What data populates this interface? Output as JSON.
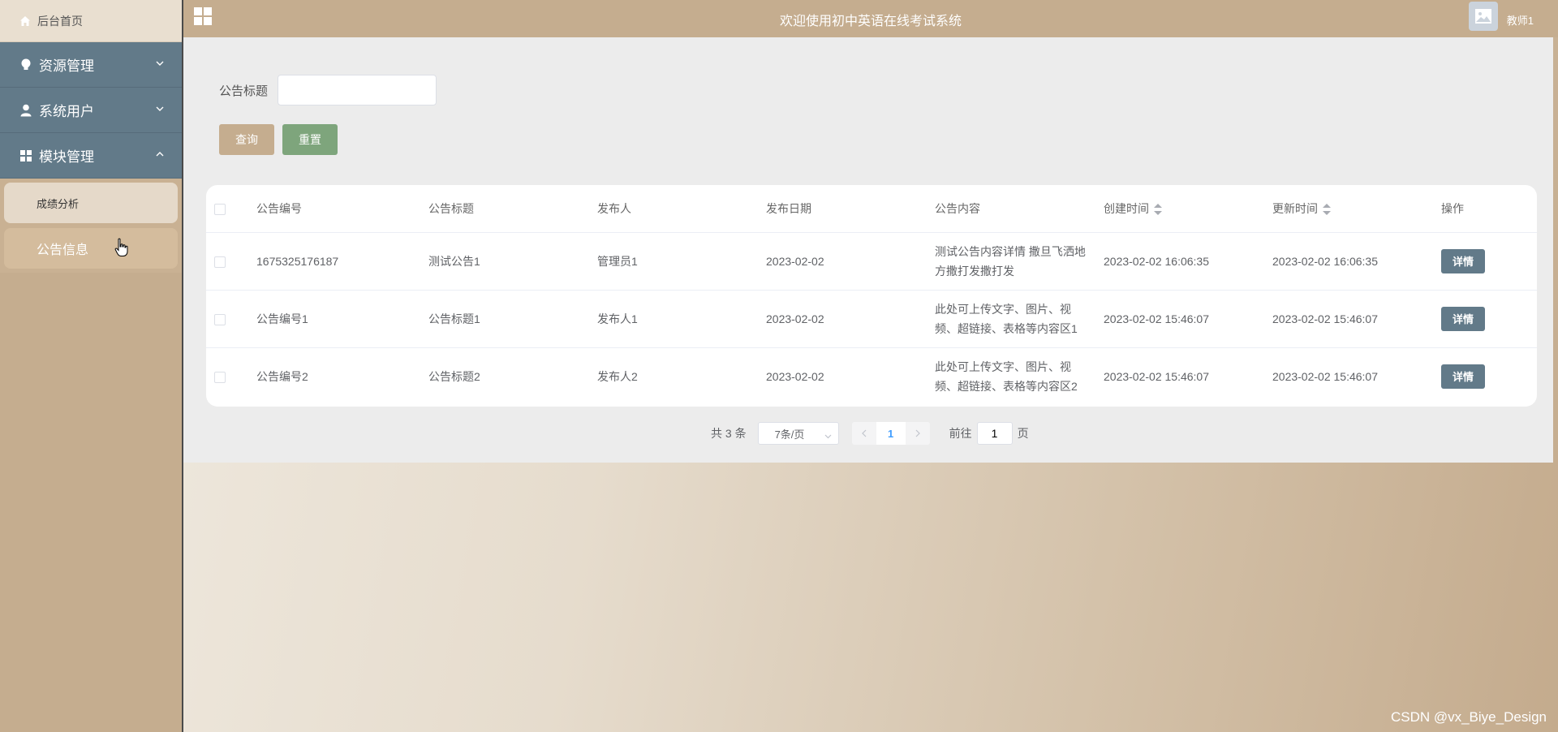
{
  "header": {
    "title": "欢迎使用初中英语在线考试系统",
    "user": "教师1"
  },
  "sidebar": {
    "home": "后台首页",
    "groups": [
      {
        "label": "资源管理",
        "icon": "bulb-icon"
      },
      {
        "label": "系统用户",
        "icon": "user-icon"
      },
      {
        "label": "模块管理",
        "icon": "grid-icon"
      }
    ],
    "sub_items": [
      {
        "label": "成绩分析"
      },
      {
        "label": "公告信息"
      }
    ]
  },
  "search": {
    "label": "公告标题",
    "value": "",
    "query_button": "查询",
    "reset_button": "重置"
  },
  "table": {
    "columns": [
      "公告编号",
      "公告标题",
      "发布人",
      "发布日期",
      "公告内容",
      "创建时间",
      "更新时间",
      "操作"
    ],
    "rows": [
      {
        "id": "1675325176187",
        "title": "测试公告1",
        "publisher": "管理员1",
        "date": "2023-02-02",
        "content": "测试公告内容详情 撒旦飞洒地方撒打发撒打发",
        "created": "2023-02-02 16:06:35",
        "updated": "2023-02-02 16:06:35",
        "action": "详情"
      },
      {
        "id": "公告编号1",
        "title": "公告标题1",
        "publisher": "发布人1",
        "date": "2023-02-02",
        "content": "此处可上传文字、图片、视频、超链接、表格等内容区1",
        "created": "2023-02-02 15:46:07",
        "updated": "2023-02-02 15:46:07",
        "action": "详情"
      },
      {
        "id": "公告编号2",
        "title": "公告标题2",
        "publisher": "发布人2",
        "date": "2023-02-02",
        "content": "此处可上传文字、图片、视频、超链接、表格等内容区2",
        "created": "2023-02-02 15:46:07",
        "updated": "2023-02-02 15:46:07",
        "action": "详情"
      }
    ]
  },
  "pagination": {
    "total": "共 3 条",
    "page_size": "7条/页",
    "current_page": "1",
    "goto_prefix": "前往",
    "goto_value": "1",
    "goto_suffix": "页"
  },
  "watermark": "CSDN @vx_Biye_Design",
  "colors": {
    "sidebar_bg": "#c5ad8f",
    "group_bg": "#627a89",
    "reset_button": "#7ea57c",
    "detail_button": "#627a89"
  }
}
